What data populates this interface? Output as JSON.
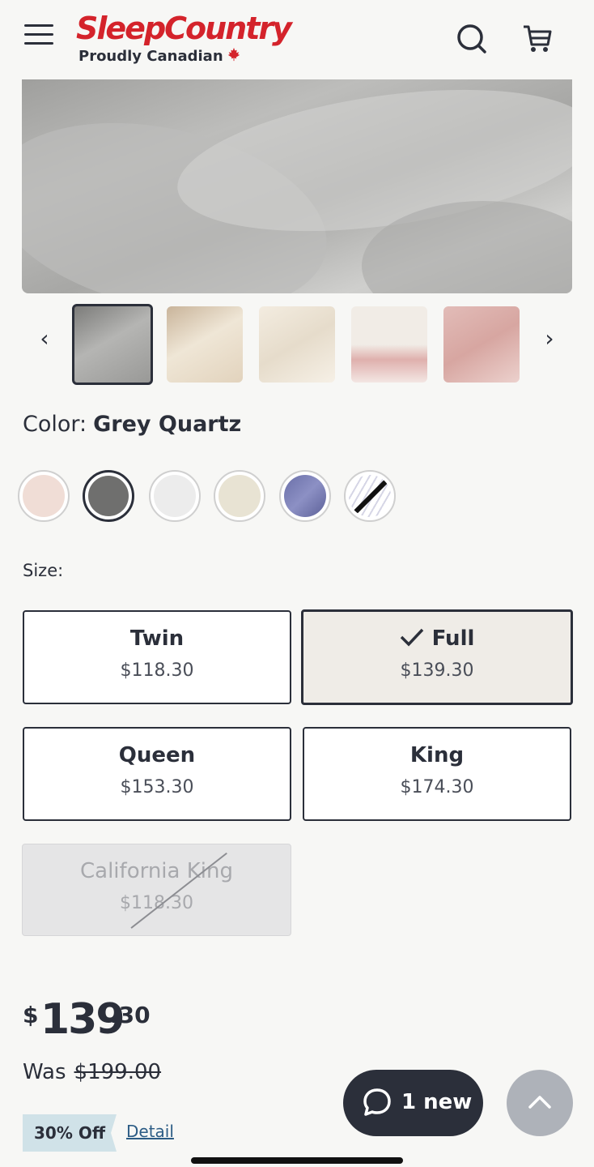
{
  "header": {
    "logo_main": "SleepCountry",
    "logo_sub": "Proudly Canadian",
    "icons": [
      "menu-icon",
      "search-icon",
      "cart-icon",
      "maple-leaf-icon"
    ]
  },
  "gallery": {
    "prev_label": "‹",
    "next_label": "›",
    "thumbnails": [
      "grey-quartz",
      "cream-bedroom",
      "ivory-sheets",
      "blush-bedroom",
      "blush-pillows"
    ]
  },
  "color": {
    "label": "Color:",
    "selected": "Grey Quartz",
    "swatches": [
      "blush",
      "grey-quartz",
      "white",
      "ivory",
      "indigo",
      "pattern"
    ]
  },
  "size": {
    "label": "Size:",
    "options": [
      {
        "name": "Twin",
        "price": "$118.30",
        "state": "available"
      },
      {
        "name": "Full",
        "price": "$139.30",
        "state": "selected"
      },
      {
        "name": "Queen",
        "price": "$153.30",
        "state": "available"
      },
      {
        "name": "King",
        "price": "$174.30",
        "state": "available"
      },
      {
        "name": "California King",
        "price": "$118.30",
        "state": "unavailable"
      }
    ]
  },
  "pricing": {
    "currency": "$",
    "whole": "139",
    "cents": ".30",
    "was_label": "Was",
    "was_price": "$199.00",
    "discount_badge": "30% Off",
    "detail_link": "Detail"
  },
  "chat": {
    "label": "1 new"
  },
  "colors": {
    "brand_red": "#d4232b",
    "text_dark": "#2b2f3a",
    "badge_bg": "#d0e2e8",
    "link_blue": "#2c5c85"
  }
}
